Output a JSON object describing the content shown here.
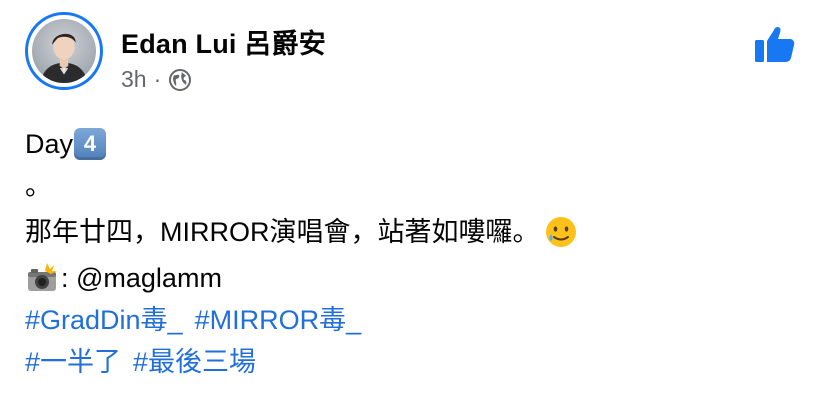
{
  "post": {
    "author": "Edan Lui 呂爵安",
    "time": "3h",
    "separator": "·",
    "privacy_icon": "globe-icon",
    "like_icon": "thumbs-up-icon",
    "accent_color": "#1877f2",
    "link_color": "#216fdb"
  },
  "body": {
    "line1_text": "Day",
    "line1_keycap": "4",
    "line2_text": "。",
    "line3_text": "那年廿四，MIRROR演唱會，站著如嘍囉。",
    "line3_emoji": "smiling-face-with-tear-emoji",
    "line4_emoji": "camera-with-flash-emoji",
    "line4_text": ": @maglamm",
    "hashtags_row1": [
      "#GradDin毒_",
      "#MIRROR毒_"
    ],
    "hashtags_row2": [
      "#一半了",
      "#最後三場"
    ]
  }
}
